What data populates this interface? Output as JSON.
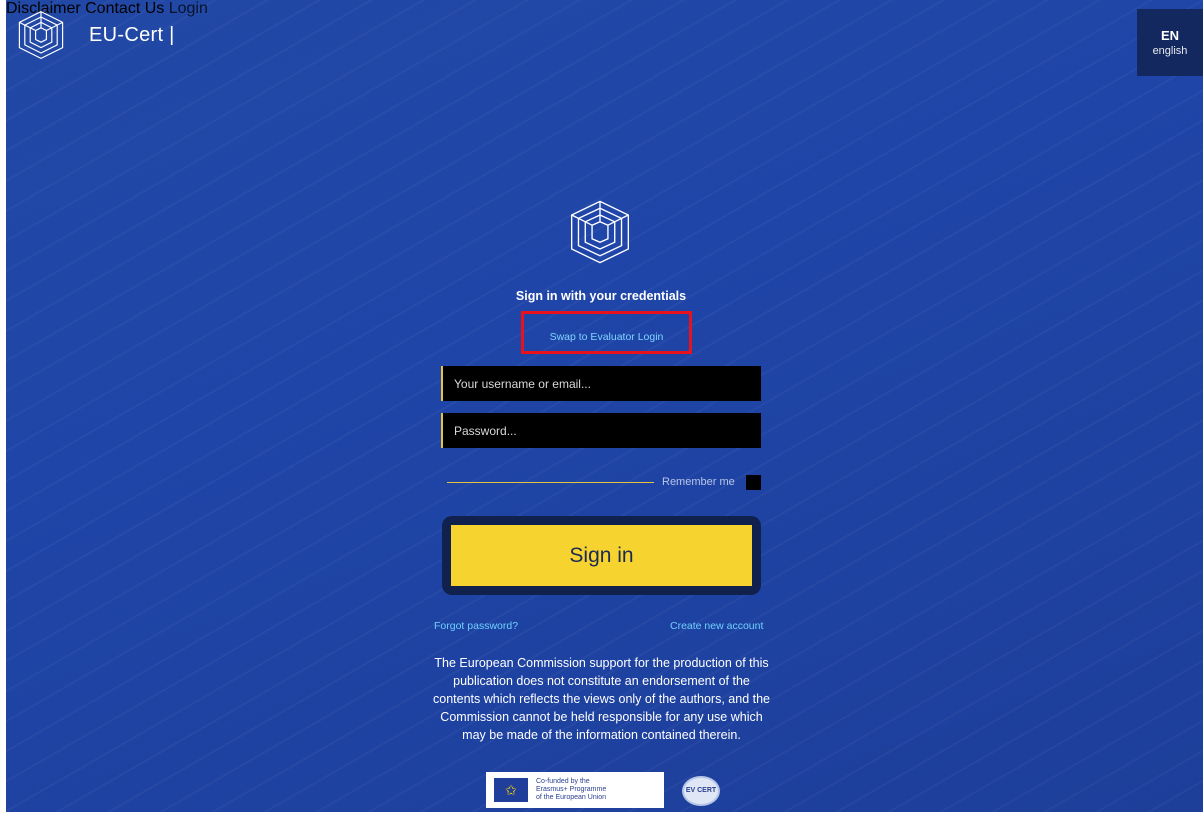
{
  "brand": {
    "name": "EU-Cert |",
    "logo_icon": "eu-cert-cube-logo"
  },
  "nav": {
    "disclaimer": "Disclaimer",
    "contact": "Contact Us",
    "login": "Login"
  },
  "language": {
    "code": "EN",
    "name": "english"
  },
  "login": {
    "heading": "Sign in with your credentials",
    "swap_link": "Swap to Evaluator Login",
    "username_placeholder": "Your username or email...",
    "password_placeholder": "Password...",
    "remember_label": "Remember me",
    "signin_label": "Sign in",
    "forgot_label": "Forgot password?",
    "create_label": "Create new account"
  },
  "disclaimer_text": "The European Commission support for the production of this publication does not constitute an endorsement of the contents which reflects the views only of the authors, and the Commission cannot be held responsible for any use which may be made of the information contained therein.",
  "footer": {
    "eu_badge_lines": [
      "Co-funded by the",
      "Erasmus+ Programme",
      "of the European Union"
    ],
    "partner_logo_text": "EV CERT"
  },
  "colors": {
    "background": "#1f45a8",
    "accent_yellow": "#f7d330",
    "link_cyan": "#7fd4ff",
    "highlight_red": "#e8121c"
  }
}
